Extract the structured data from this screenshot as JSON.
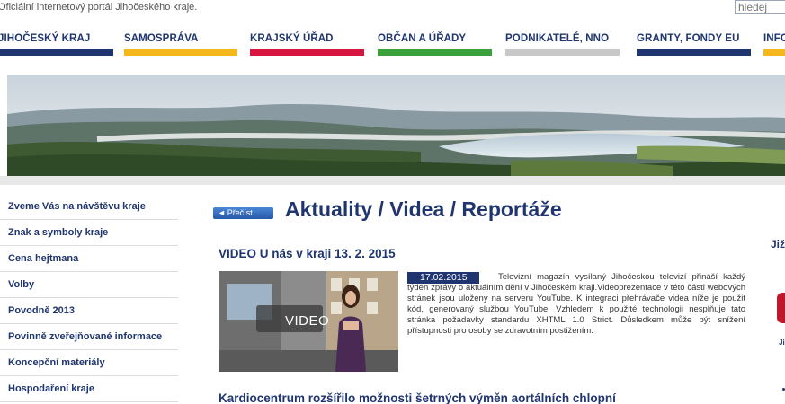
{
  "header": {
    "tagline": "Oficiální internetový portál Jihočeského kraje.",
    "search_placeholder": "hledej"
  },
  "nav": {
    "items": [
      {
        "label": "JIHOČESKÝ KRAJ",
        "color": "#1f3570"
      },
      {
        "label": "SAMOSPRÁVA",
        "color": "#f5b81c"
      },
      {
        "label": "KRAJSKÝ ÚŘAD",
        "color": "#d6163f"
      },
      {
        "label": "OBČAN A ÚŘADY",
        "color": "#3aa13a"
      },
      {
        "label": "PODNIKATELÉ, NNO",
        "color": "#c8c8c8"
      },
      {
        "label": "GRANTY, FONDY EU",
        "color": "#1f3570"
      },
      {
        "label": "INFO",
        "color": "#f5b81c"
      }
    ]
  },
  "sidebar": {
    "items": [
      {
        "label": "Zveme Vás na návštěvu kraje"
      },
      {
        "label": "Znak a symboly kraje"
      },
      {
        "label": "Cena hejtmana"
      },
      {
        "label": "Volby"
      },
      {
        "label": "Povodně 2013"
      },
      {
        "label": "Povinně zveřejňované informace"
      },
      {
        "label": "Koncepční materiály"
      },
      {
        "label": "Hospodaření kraje"
      }
    ]
  },
  "main": {
    "read_button_label": "Přečíst",
    "page_title": "Aktuality / Videa / Reportáže",
    "article1": {
      "title": "VIDEO U nás v kraji 13. 2. 2015",
      "video_label": "VIDEO",
      "date": "17.02.2015",
      "text": "Televizní magazín vysílaný Jihočeskou televizí přináší každý týden zprávy o aktuálním dění v Jihočeském kraji.Videoprezentace v této části webových stránek jsou uloženy na serveru YouTube. K integraci přehrávače videa níže je použit kód, generovaný službou YouTube. Vzhledem k použité technologii nesplňuje tato stránka požadavky standardu XHTML 1.0 Strict. Důsledkem může být snížení přístupnosti pro osoby se zdravotním postižením."
    },
    "article2": {
      "title": "Kardiocentrum rozšířilo možnosti šetrných výměn aortálních chlopní"
    }
  },
  "right_column": {
    "heading": "Již",
    "caption": "Ji"
  },
  "colors": {
    "brand_blue": "#1f3570",
    "accent_red": "#c0182a"
  },
  "icons": {
    "read_button": "speaker-icon"
  }
}
